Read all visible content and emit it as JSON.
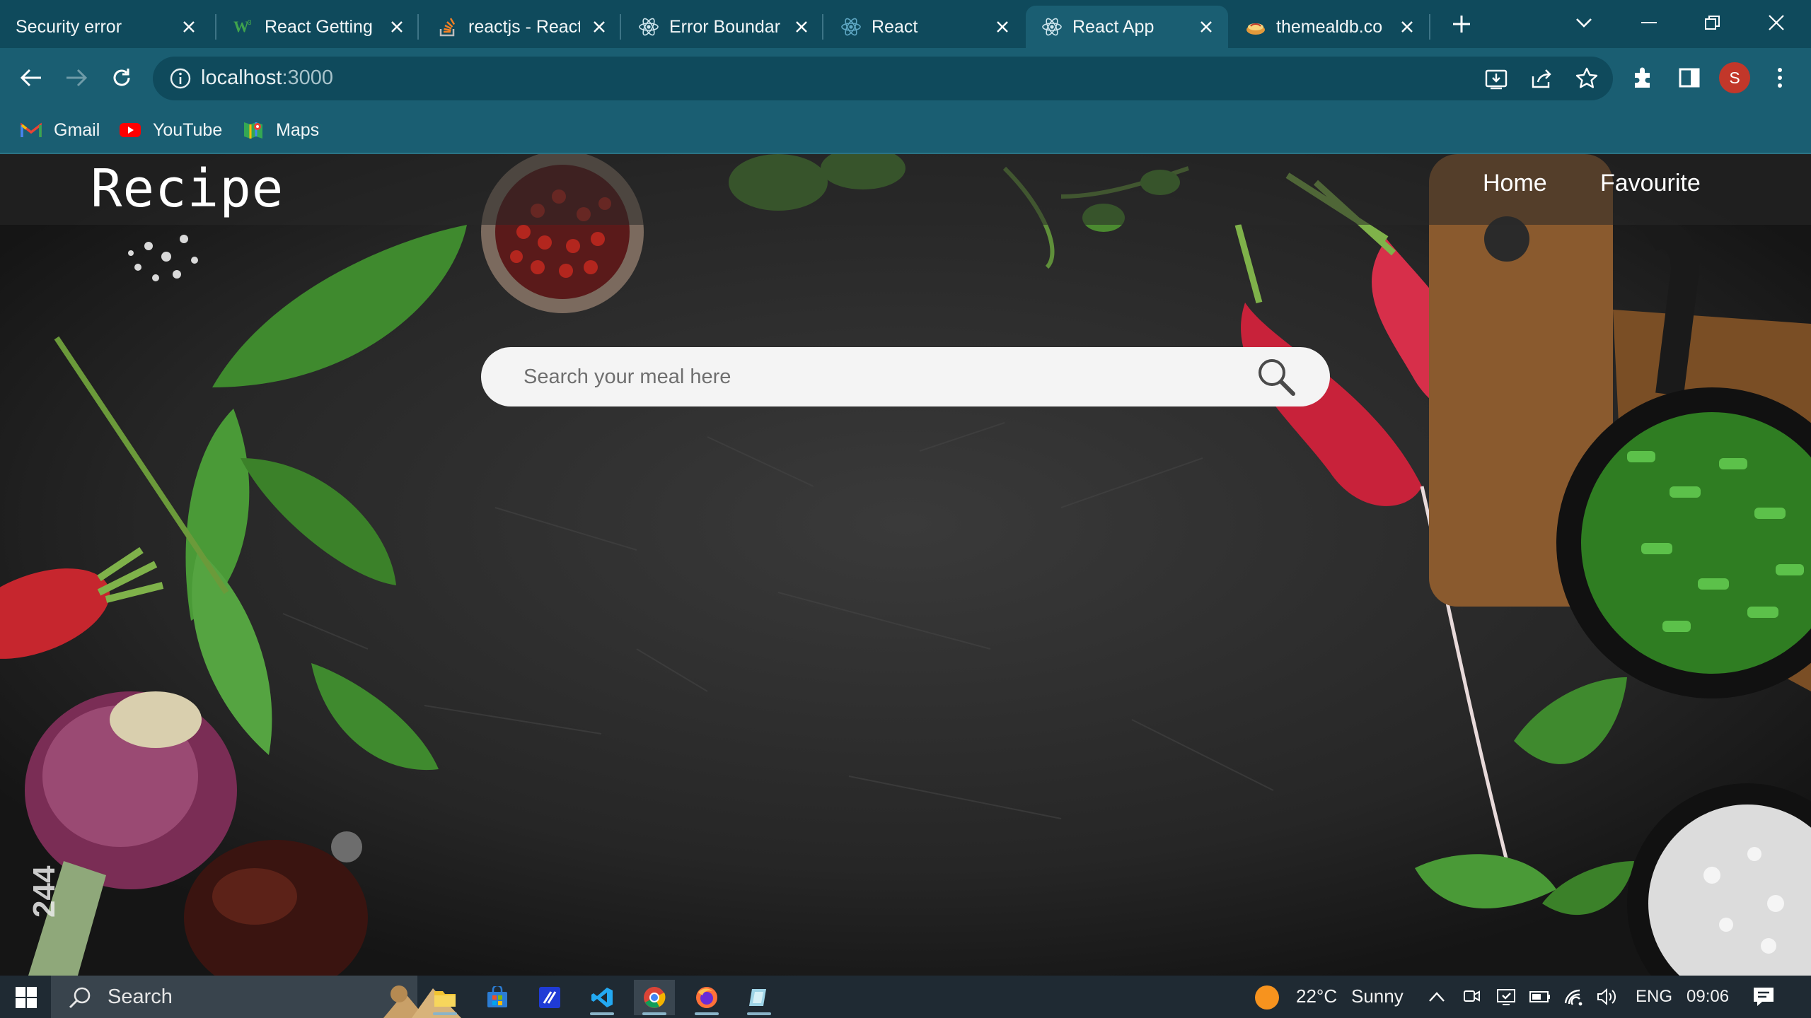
{
  "browser": {
    "tabs": [
      {
        "title": "Security error",
        "favicon": "none"
      },
      {
        "title": "React Getting",
        "favicon": "w3schools-icon"
      },
      {
        "title": "reactjs - React",
        "favicon": "stackoverflow-icon"
      },
      {
        "title": "Error Boundar",
        "favicon": "react-icon"
      },
      {
        "title": "React",
        "favicon": "react-icon"
      },
      {
        "title": "React App",
        "favicon": "react-icon",
        "active": true
      },
      {
        "title": "themealdb.co",
        "favicon": "themealdb-icon"
      }
    ],
    "url": {
      "host": "localhost",
      "port": ":3000"
    },
    "profile_initial": "S",
    "bookmarks": [
      {
        "label": "Gmail",
        "icon": "gmail-icon"
      },
      {
        "label": "YouTube",
        "icon": "youtube-icon"
      },
      {
        "label": "Maps",
        "icon": "maps-icon"
      }
    ]
  },
  "app": {
    "brand": "Recipe",
    "nav": {
      "home": "Home",
      "favourite": "Favourite"
    },
    "search": {
      "placeholder": "Search your meal here",
      "value": ""
    },
    "image_id_text": "244"
  },
  "taskbar": {
    "search_label": "Search",
    "weather": {
      "temp": "22°C",
      "condition": "Sunny"
    },
    "language": "ENG",
    "time": "09:06",
    "apps": [
      "file-explorer-icon",
      "store-icon",
      "editor-icon",
      "vscode-icon",
      "chrome-icon",
      "firefox-icon",
      "app-icon"
    ]
  },
  "colors": {
    "tab_strip": "#0f4a5c",
    "toolbar": "#1a5e72",
    "avatar": "#c2372a",
    "page_background": "#2a2a2a"
  }
}
